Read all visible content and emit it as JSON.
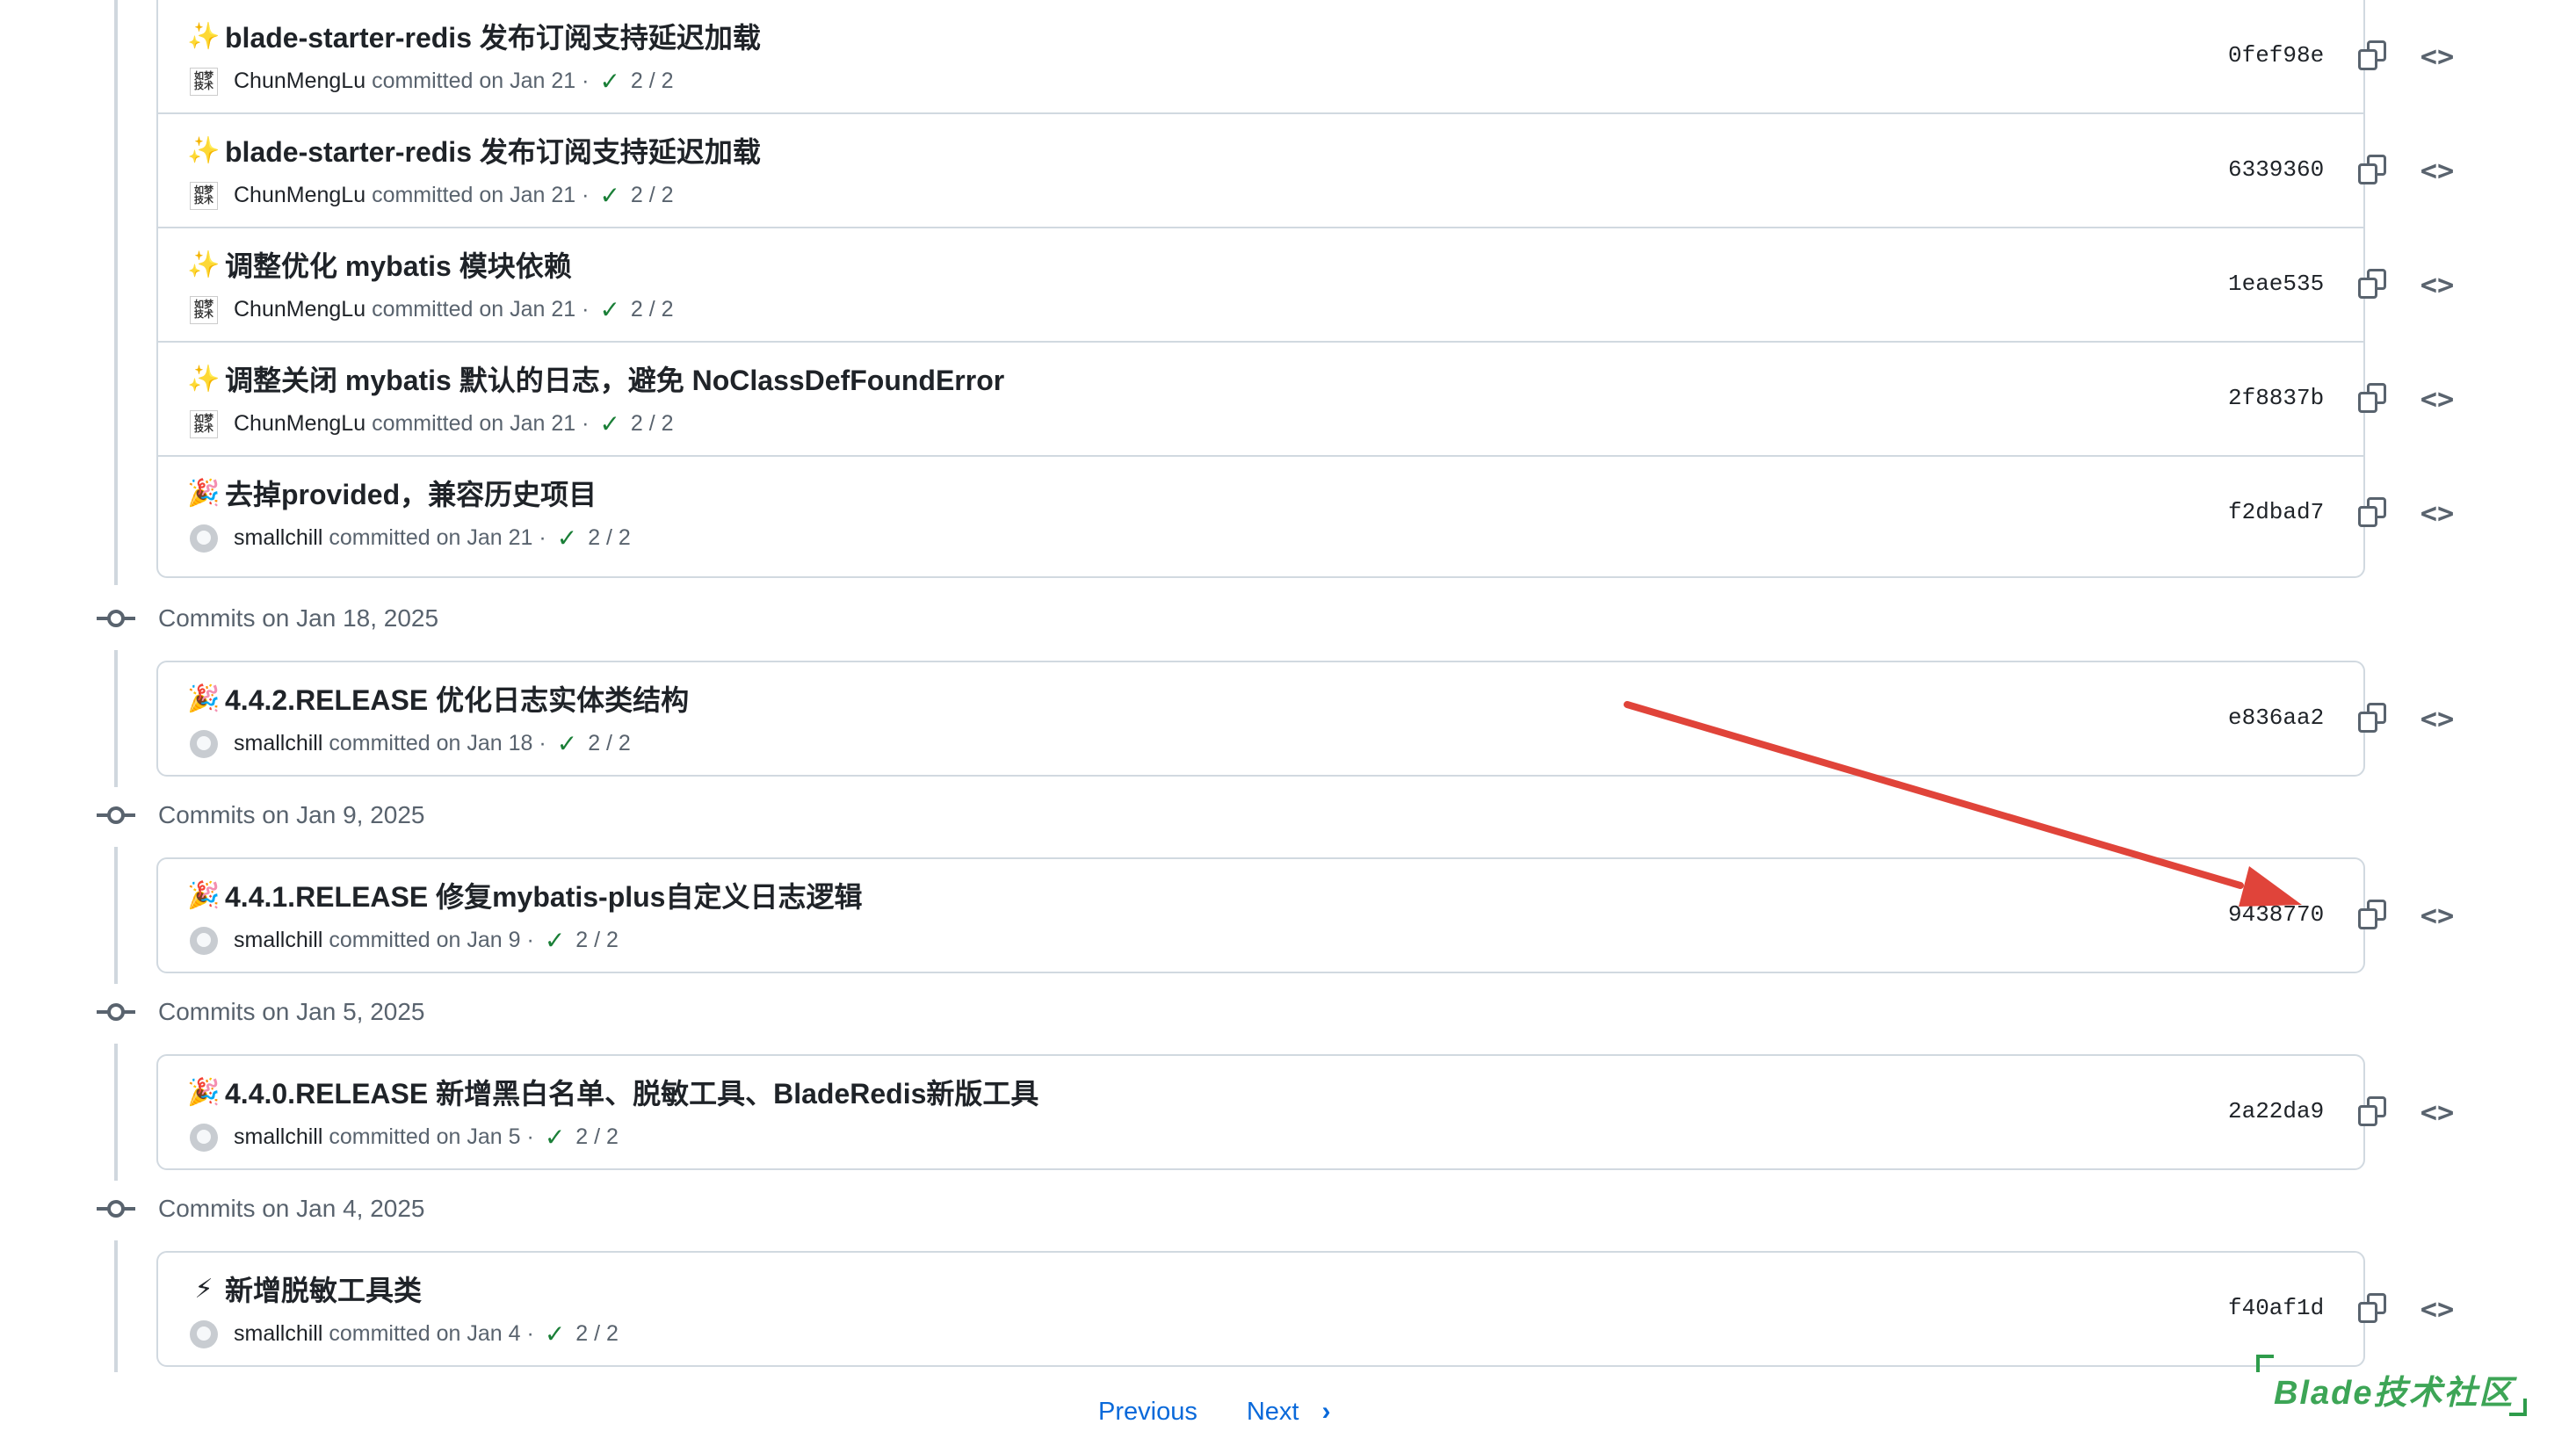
{
  "groups": [
    {
      "title": "",
      "commits": [
        {
          "emoji": "✨",
          "message": "blade-starter-redis 发布订阅支持延迟加载",
          "author": "ChunMengLu",
          "committed": "committed on Jan 21",
          "checks": "2 / 2",
          "sha": "0fef98e",
          "avatar": "cml"
        },
        {
          "emoji": "✨",
          "message": "blade-starter-redis 发布订阅支持延迟加载",
          "author": "ChunMengLu",
          "committed": "committed on Jan 21",
          "checks": "2 / 2",
          "sha": "6339360",
          "avatar": "cml"
        },
        {
          "emoji": "✨",
          "message": "调整优化 mybatis 模块依赖",
          "author": "ChunMengLu",
          "committed": "committed on Jan 21",
          "checks": "2 / 2",
          "sha": "1eae535",
          "avatar": "cml"
        },
        {
          "emoji": "✨",
          "message": "调整关闭 mybatis 默认的日志，避免 NoClassDefFoundError",
          "author": "ChunMengLu",
          "committed": "committed on Jan 21",
          "checks": "2 / 2",
          "sha": "2f8837b",
          "avatar": "cml"
        },
        {
          "emoji": "🎉",
          "message": "去掉provided，兼容历史项目",
          "author": "smallchill",
          "committed": "committed on Jan 21",
          "checks": "2 / 2",
          "sha": "f2dbad7",
          "avatar": "gh"
        }
      ]
    },
    {
      "title": "Commits on Jan 18, 2025",
      "commits": [
        {
          "emoji": "🎉",
          "message": "4.4.2.RELEASE 优化日志实体类结构",
          "author": "smallchill",
          "committed": "committed on Jan 18",
          "checks": "2 / 2",
          "sha": "e836aa2",
          "avatar": "gh"
        }
      ]
    },
    {
      "title": "Commits on Jan 9, 2025",
      "commits": [
        {
          "emoji": "🎉",
          "message": "4.4.1.RELEASE 修复mybatis-plus自定义日志逻辑",
          "author": "smallchill",
          "committed": "committed on Jan 9",
          "checks": "2 / 2",
          "sha": "9438770",
          "avatar": "gh"
        }
      ]
    },
    {
      "title": "Commits on Jan 5, 2025",
      "commits": [
        {
          "emoji": "🎉",
          "message": "4.4.0.RELEASE 新增黑白名单、脱敏工具、BladeRedis新版工具",
          "author": "smallchill",
          "committed": "committed on Jan 5",
          "checks": "2 / 2",
          "sha": "2a22da9",
          "avatar": "gh"
        }
      ]
    },
    {
      "title": "Commits on Jan 4, 2025",
      "commits": [
        {
          "emoji": "⚡",
          "message": "新增脱敏工具类",
          "author": "smallchill",
          "committed": "committed on Jan 4",
          "checks": "2 / 2",
          "sha": "f40af1d",
          "avatar": "gh"
        }
      ]
    }
  ],
  "avatar_text": {
    "cml": "如梦技术"
  },
  "pagination": {
    "previous": "Previous",
    "next": "Next"
  },
  "watermark": {
    "text": "Blade技术社区"
  },
  "colors": {
    "accent": "#0969da",
    "check": "#1a7f37",
    "arrow": "#e0443a",
    "watermark": "#3da556"
  },
  "icons": {
    "copy": "copy-icon",
    "code": "code-icon",
    "commit_node": "git-commit-icon",
    "check": "check-icon"
  }
}
